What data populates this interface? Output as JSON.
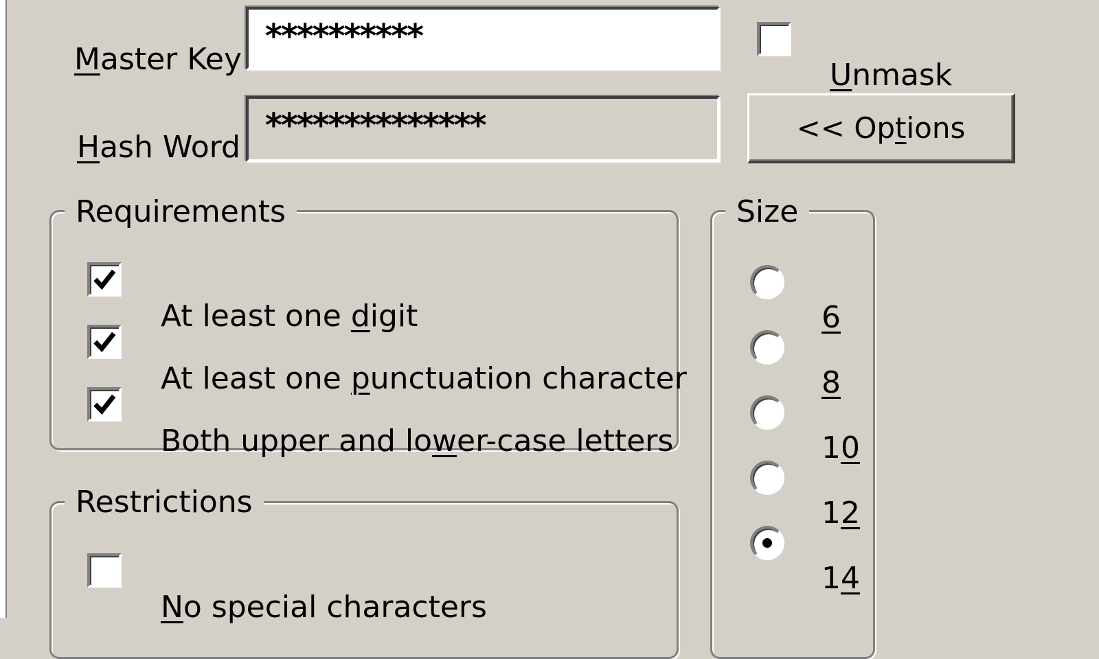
{
  "fields": {
    "master_key": {
      "label_underlined": "M",
      "label_rest": "aster Key",
      "value": "**********"
    },
    "hash_word": {
      "label_underlined": "H",
      "label_rest": "ash Word",
      "value": "**************"
    }
  },
  "unmask": {
    "label_underlined": "U",
    "label_rest": "nmask",
    "checked": false
  },
  "options_button": {
    "label_before": "<< Op",
    "label_underlined": "t",
    "label_after": "ions"
  },
  "requirements": {
    "title": "Requirements",
    "items": [
      {
        "before": "At least one ",
        "underlined": "d",
        "after": "igit",
        "checked": true
      },
      {
        "before": "At least one ",
        "underlined": "p",
        "after": "unctuation character",
        "checked": true
      },
      {
        "before": "Both upper and lo",
        "underlined": "w",
        "after": "er-case letters",
        "checked": true
      }
    ]
  },
  "restrictions": {
    "title": "Restrictions",
    "items": [
      {
        "before": "",
        "underlined": "N",
        "after": "o special characters",
        "checked": false
      }
    ]
  },
  "size": {
    "title": "Size",
    "options": [
      {
        "before": "",
        "underlined": "6",
        "selected": false
      },
      {
        "before": "",
        "underlined": "8",
        "selected": false
      },
      {
        "before": "1",
        "underlined": "0",
        "selected": false
      },
      {
        "before": "1",
        "underlined": "2",
        "selected": false
      },
      {
        "before": "1",
        "underlined": "4",
        "selected": true
      }
    ],
    "selected_value": "14"
  }
}
